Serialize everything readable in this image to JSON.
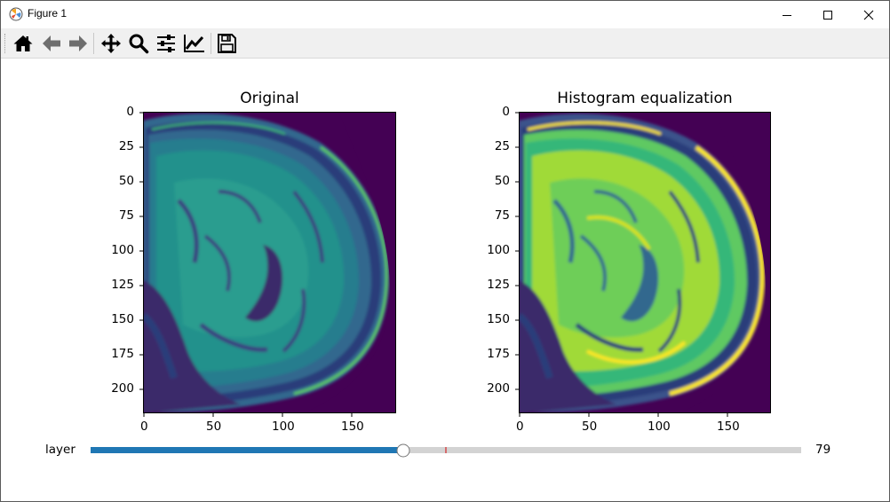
{
  "window": {
    "title": "Figure 1"
  },
  "toolbar": {
    "tools": [
      "home-icon",
      "back-icon",
      "forward-icon",
      "pan-icon",
      "zoom-icon",
      "subplots-icon",
      "customize-icon",
      "save-icon"
    ]
  },
  "figure": {
    "axes": [
      {
        "title": "Original",
        "xticks": [
          "0",
          "50",
          "100",
          "150"
        ],
        "yticks": [
          "0",
          "25",
          "50",
          "75",
          "100",
          "125",
          "150",
          "175",
          "200"
        ],
        "colormap": "viridis"
      },
      {
        "title": "Histogram equalization",
        "xticks": [
          "0",
          "50",
          "100",
          "150"
        ],
        "yticks": [
          "0",
          "25",
          "50",
          "75",
          "100",
          "125",
          "150",
          "175",
          "200"
        ],
        "colormap": "viridis"
      }
    ],
    "slider": {
      "label": "layer",
      "value": "79",
      "fraction": 0.44,
      "initial_fraction": 0.5,
      "fill_color": "#1f77b4",
      "track_color": "#d3d3d3",
      "marker_color": "#d62728"
    }
  }
}
